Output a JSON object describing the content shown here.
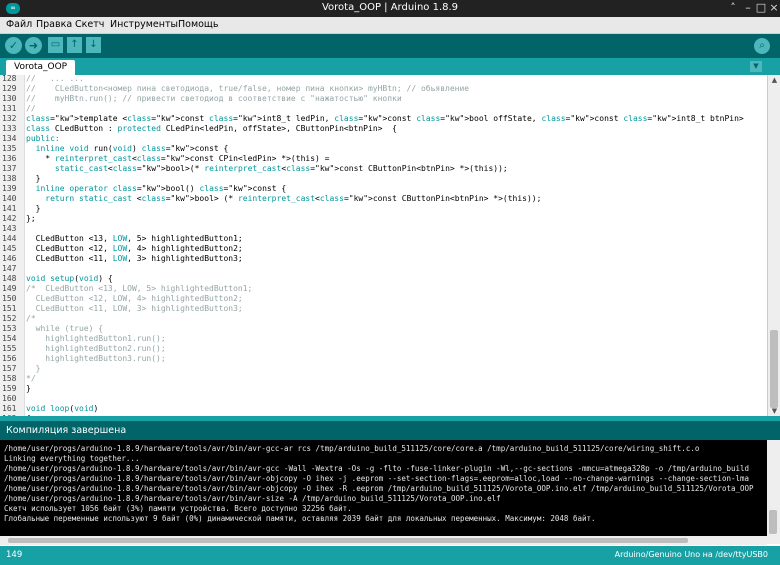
{
  "window": {
    "title": "Vorota_OOP | Arduino 1.8.9",
    "controls": [
      "˄",
      "–",
      "□",
      "×"
    ]
  },
  "menu": [
    "Файл",
    "Правка",
    "Скетч",
    "Инструменты",
    "Помощь"
  ],
  "toolbar": {
    "verify": "✓",
    "upload": "➜",
    "new": "▭",
    "open": "↑",
    "save": "↓",
    "serial_monitor": "⌕"
  },
  "tabs": {
    "active": "Vorota_OOP",
    "menu": "▼"
  },
  "editor": {
    "lines": [
      {
        "n": "128",
        "t": "//   ... ..."
      },
      {
        "n": "129",
        "t": "//    CLedButton<номер пина светодиода, true/false, номер пина кнопки> myHBtn; // обьявление"
      },
      {
        "n": "130",
        "t": "//    myHBtn.run(); // привести светодиод в соответствие с \"нажатостью\" кнопки"
      },
      {
        "n": "131",
        "t": "//"
      },
      {
        "n": "132",
        "t": "template <const int8_t ledPin, const bool offState, const int8_t btnPin>"
      },
      {
        "n": "133",
        "t": "class CLedButton : protected CLedPin<ledPin, offState>, CButtonPin<btnPin>  {"
      },
      {
        "n": "134",
        "t": "public:"
      },
      {
        "n": "135",
        "t": "  inline void run(void) const {"
      },
      {
        "n": "136",
        "t": "    * reinterpret_cast<const CPin<ledPin> *>(this) ="
      },
      {
        "n": "137",
        "t": "      static_cast<bool>(* reinterpret_cast<const CButtonPin<btnPin> *>(this));"
      },
      {
        "n": "138",
        "t": "  }"
      },
      {
        "n": "139",
        "t": "  inline operator bool() const {"
      },
      {
        "n": "140",
        "t": "    return static_cast <bool> (* reinterpret_cast<const CButtonPin<btnPin> *>(this));"
      },
      {
        "n": "141",
        "t": "  }"
      },
      {
        "n": "142",
        "t": "};"
      },
      {
        "n": "143",
        "t": ""
      },
      {
        "n": "144",
        "t": "  CLedButton <13, LOW, 5> highlightedButton1;"
      },
      {
        "n": "145",
        "t": "  CLedButton <12, LOW, 4> highlightedButton2;"
      },
      {
        "n": "146",
        "t": "  CLedButton <11, LOW, 3> highlightedButton3;"
      },
      {
        "n": "147",
        "t": ""
      },
      {
        "n": "148",
        "t": "void setup(void) {"
      },
      {
        "n": "149",
        "t": "/*  CLedButton <13, LOW, 5> highlightedButton1;"
      },
      {
        "n": "150",
        "t": "  CLedButton <12, LOW, 4> highlightedButton2;"
      },
      {
        "n": "151",
        "t": "  CLedButton <11, LOW, 3> highlightedButton3;"
      },
      {
        "n": "152",
        "t": "/*"
      },
      {
        "n": "153",
        "t": "  while (true) {"
      },
      {
        "n": "154",
        "t": "    highlightedButton1.run();"
      },
      {
        "n": "155",
        "t": "    highlightedButton2.run();"
      },
      {
        "n": "156",
        "t": "    highlightedButton3.run();"
      },
      {
        "n": "157",
        "t": "  }"
      },
      {
        "n": "158",
        "t": "*/"
      },
      {
        "n": "159",
        "t": "}"
      },
      {
        "n": "160",
        "t": ""
      },
      {
        "n": "161",
        "t": "void loop(void)"
      },
      {
        "n": "162",
        "t": "{"
      }
    ]
  },
  "status": {
    "text": "Компиляция завершена"
  },
  "console": {
    "lines": [
      "/home/user/progs/arduino-1.8.9/hardware/tools/avr/bin/avr-gcc-ar rcs /tmp/arduino_build_511125/core/core.a /tmp/arduino_build_511125/core/wiring_shift.c.o",
      "Linking everything together...",
      "/home/user/progs/arduino-1.8.9/hardware/tools/avr/bin/avr-gcc -Wall -Wextra -Os -g -flto -fuse-linker-plugin -Wl,--gc-sections -mmcu=atmega328p -o /tmp/arduino_build",
      "/home/user/progs/arduino-1.8.9/hardware/tools/avr/bin/avr-objcopy -O ihex -j .eeprom --set-section-flags=.eeprom=alloc,load --no-change-warnings --change-section-lma",
      "/home/user/progs/arduino-1.8.9/hardware/tools/avr/bin/avr-objcopy -O ihex -R .eeprom /tmp/arduino_build_511125/Vorota_OOP.ino.elf /tmp/arduino_build_511125/Vorota_OOP",
      "/home/user/progs/arduino-1.8.9/hardware/tools/avr/bin/avr-size -A /tmp/arduino_build_511125/Vorota_OOP.ino.elf",
      "Скетч использует 1056 байт (3%) памяти устройства. Всего доступно 32256 байт.",
      "Глобальные переменные используют 9 байт (0%) динамической памяти, оставляя 2039 байт для локальных переменных. Максимум: 2048 байт."
    ]
  },
  "bottom": {
    "line_number": "149",
    "board": "Arduino/Genuino Uno на /dev/ttyUSB0"
  }
}
